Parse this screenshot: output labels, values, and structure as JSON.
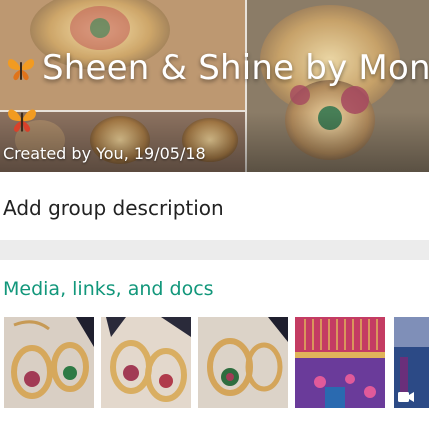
{
  "header": {
    "group_name": "Sheen & Shine by Mona",
    "created_by": "Created by You, 19/05/18"
  },
  "description": {
    "placeholder": "Add group description"
  },
  "media": {
    "heading": "Media, links, and docs",
    "thumbnails": [
      {
        "kind": "image",
        "subject": "earrings-1"
      },
      {
        "kind": "image",
        "subject": "earrings-2"
      },
      {
        "kind": "image",
        "subject": "earrings-3"
      },
      {
        "kind": "image",
        "subject": "saree"
      },
      {
        "kind": "video",
        "subject": "saree-video"
      }
    ]
  },
  "colors": {
    "accent": "#12977b",
    "divider": "#ececec"
  },
  "icons": {
    "title_emoji": "butterfly-icon",
    "creator_emoji": "butterfly-icon",
    "video_badge": "video-camera-icon"
  }
}
